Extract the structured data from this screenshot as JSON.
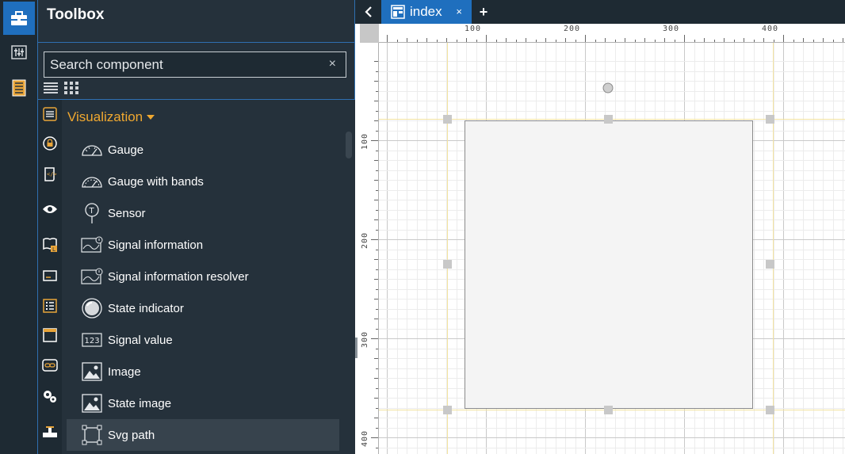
{
  "toolbox": {
    "title": "Toolbox",
    "search_placeholder": "Search component",
    "clear_symbol": "×"
  },
  "category": {
    "heading": "Visualization"
  },
  "components": [
    {
      "label": "Gauge",
      "icon": "gauge-icon"
    },
    {
      "label": "Gauge with bands",
      "icon": "gauge-bands-icon"
    },
    {
      "label": "Sensor",
      "icon": "sensor-icon"
    },
    {
      "label": "Signal information",
      "icon": "signal-info-icon"
    },
    {
      "label": "Signal information resolver",
      "icon": "signal-info-resolver-icon"
    },
    {
      "label": "State indicator",
      "icon": "state-indicator-icon"
    },
    {
      "label": "Signal value",
      "icon": "signal-value-icon"
    },
    {
      "label": "Image",
      "icon": "image-icon"
    },
    {
      "label": "State image",
      "icon": "state-image-icon"
    },
    {
      "label": "Svg path",
      "icon": "svg-path-icon"
    }
  ],
  "signal_value_glyph": "123",
  "sensor_glyph": "T",
  "tabs": [
    {
      "label": "index",
      "close": "×"
    }
  ],
  "tab_add": "+",
  "ruler": {
    "h_labels": [
      "100",
      "200",
      "300",
      "400"
    ],
    "v_labels": [
      "100",
      "200",
      "300",
      "400"
    ]
  },
  "colors": {
    "accent": "#1f6fbe",
    "category": "#f0a830",
    "panel": "#25313b",
    "rail": "#1e2a33",
    "guide": "#f3e3a0"
  }
}
